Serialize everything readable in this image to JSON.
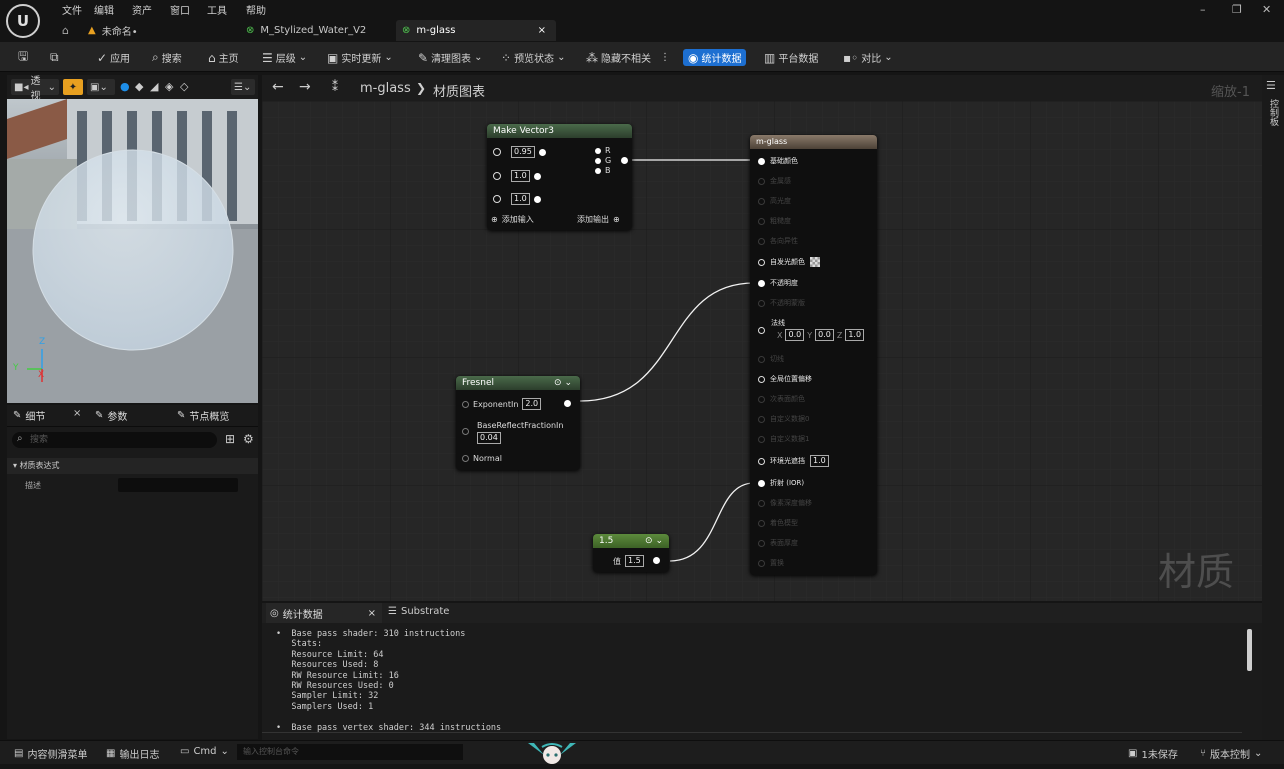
{
  "menu": [
    "文件",
    "编辑",
    "资产",
    "窗口",
    "工具",
    "帮助"
  ],
  "tabs": {
    "project": "未命名•",
    "doc1": "M_Stylized_Water_V2",
    "doc2": "m-glass",
    "close": "×"
  },
  "window": {
    "min": "–",
    "restore": "❐",
    "close": "✕"
  },
  "toolbar": {
    "apply": "应用",
    "search": "搜索",
    "home": "主页",
    "hierarchy": "层级",
    "live_update": "实时更新",
    "clean_graph": "清理图表",
    "preview_state": "预览状态",
    "hide_unrelated": "隐藏不相关",
    "stats": "统计数据",
    "platform_stats": "平台数据",
    "diff": "对比",
    "highlight_color": "#1d6fd1"
  },
  "viewport": {
    "mode": "透视",
    "axis": {
      "z": "Z",
      "y": "Y",
      "x": "X"
    }
  },
  "details": {
    "tab_details": "细节",
    "tab_params": "参数",
    "tab_nodes": "节点概览",
    "close": "×",
    "search_placeholder": "搜索",
    "category": "材质表达式",
    "prop_desc": "描述"
  },
  "graph": {
    "breadcrumb_root": "m-glass",
    "breadcrumb_sep": "❯",
    "breadcrumb_leaf": "材质图表",
    "zoom": "缩放-1",
    "watermark": "材质",
    "side_label": "控制板"
  },
  "make_vector3": {
    "title": "Make Vector3",
    "r": "0.95",
    "g": "1.0",
    "b": "1.0",
    "out_r": "R",
    "out_g": "G",
    "out_b": "B",
    "add_input": "添加输入",
    "add_output": "添加输出"
  },
  "fresnel": {
    "title": "Fresnel",
    "exponent_label": "ExponentIn",
    "exponent": "2.0",
    "base_reflect_label": "BaseReflectFractionIn",
    "base_reflect": "0.04",
    "normal_label": "Normal"
  },
  "constant": {
    "title": "1.5",
    "label": "值",
    "value": "1.5"
  },
  "material": {
    "title": "m-glass",
    "base_color": "基础颜色",
    "metallic": "金属感",
    "specular": "高光度",
    "roughness": "粗糙度",
    "anisotropy": "各向异性",
    "emissive": "自发光颜色",
    "opacity": "不透明度",
    "opacity_mask": "不透明蒙版",
    "normal": "法线",
    "normal_x": "0.0",
    "normal_y": "0.0",
    "normal_z": "1.0",
    "lbl_x": "X",
    "lbl_y": "Y",
    "lbl_z": "Z",
    "tangent": "切线",
    "wpo": "全局位置偏移",
    "subsurface": "次表面颜色",
    "custom0": "自定义数据0",
    "custom1": "自定义数据1",
    "ao": "环境光遮挡",
    "ao_value": "1.0",
    "refraction": "折射 (IOR)",
    "pixel_depth": "像素深度偏移",
    "shading_model": "着色模型",
    "surface_thickness": "表面厚度",
    "displacement": "置换"
  },
  "stats": {
    "tab_stats": "统计数据",
    "tab_close": "×",
    "tab_substrate": "Substrate",
    "lines": [
      "•  Base pass shader: 310 instructions",
      "   Stats:",
      "   Resource Limit: 64",
      "   Resources Used: 8",
      "   RW Resource Limit: 16",
      "   RW Resources Used: 0",
      "   Sampler Limit: 32",
      "   Samplers Used: 1",
      "",
      "•  Base pass vertex shader: 344 instructions"
    ]
  },
  "bottom": {
    "content_drawer": "内容侧滑菜单",
    "output_log": "输出日志",
    "cmd": "Cmd",
    "cmd_placeholder": "输入控制台命令",
    "unsaved": "1未保存",
    "source_control": "版本控制"
  }
}
